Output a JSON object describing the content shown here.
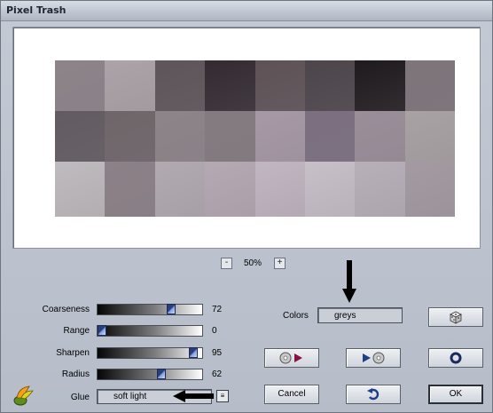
{
  "window": {
    "title": "Pixel Trash"
  },
  "preview": {
    "colors": [
      "#8c8489",
      "#aca3a8",
      "#5d5559",
      "#332b31",
      "#5e5256",
      "#4c454a",
      "#1f1a1d",
      "#7d757a",
      "#625b60",
      "#6e6669",
      "#8d8489",
      "#847b80",
      "#a799a6",
      "#7c7080",
      "#9a8e99",
      "#a8a2a4",
      "#c0bbbe",
      "#8b8187",
      "#b1aab0",
      "#b5a9b3",
      "#c1b6c1",
      "#c8c0c8",
      "#b8b0b9",
      "#a39aa2"
    ]
  },
  "zoom": {
    "minus": "-",
    "value": "50%",
    "plus": "+"
  },
  "sliders": [
    {
      "label": "Coarseness",
      "value": "72",
      "fraction": 0.72
    },
    {
      "label": "Range",
      "value": "0",
      "fraction": 0.0
    },
    {
      "label": "Sharpen",
      "value": "95",
      "fraction": 0.95
    },
    {
      "label": "Radius",
      "value": "62",
      "fraction": 0.62
    }
  ],
  "glue": {
    "label": "Glue",
    "value": "soft light",
    "dropdown_icon": "list-icon"
  },
  "colors": {
    "label": "Colors",
    "value": "greys"
  },
  "buttons": {
    "random_icon": "dice-icon",
    "load_icon": "disc-to-play-icon",
    "save_icon": "play-to-disc-icon",
    "reset_icon": "circle-icon",
    "cancel": "Cancel",
    "undo_icon": "undo-icon",
    "ok": "OK"
  },
  "logo_icon": "plugin-logo-icon"
}
